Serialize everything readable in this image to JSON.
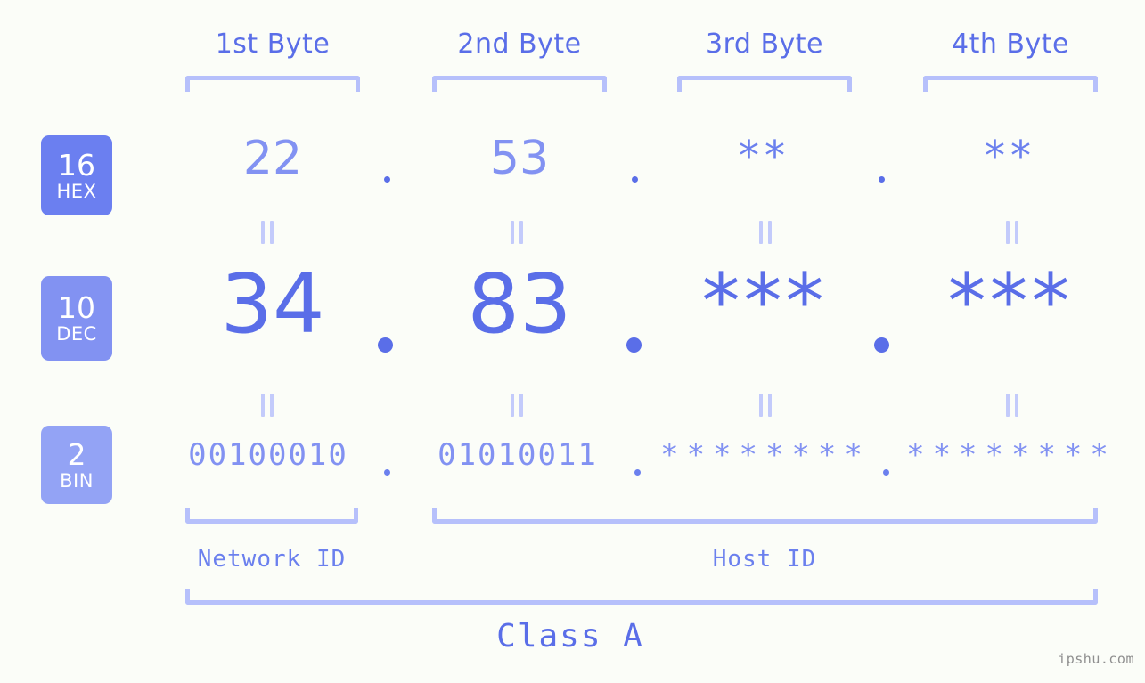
{
  "page": {
    "background_color": "#fbfdf8",
    "accent_color": "#5a6ee8",
    "accent_light_color": "#b6c0fb",
    "watermark": "ipshu.com"
  },
  "byte_headers": [
    {
      "label": "1st Byte"
    },
    {
      "label": "2nd Byte"
    },
    {
      "label": "3rd Byte"
    },
    {
      "label": "4th Byte"
    }
  ],
  "radix_badges": [
    {
      "number": "16",
      "name": "HEX",
      "color": "#6b7ff0"
    },
    {
      "number": "10",
      "name": "DEC",
      "color": "#8292f2"
    },
    {
      "number": "2",
      "name": "BIN",
      "color": "#93a3f5"
    }
  ],
  "rows": {
    "hex": {
      "radix": "16",
      "radix_name": "HEX",
      "bytes": [
        "22",
        "53",
        "**",
        "**"
      ],
      "separator": "."
    },
    "dec": {
      "radix": "10",
      "radix_name": "DEC",
      "bytes": [
        "34",
        "83",
        "***",
        "***"
      ],
      "separator": "."
    },
    "bin": {
      "radix": "2",
      "radix_name": "BIN",
      "bytes": [
        "00100010",
        "01010011",
        "********",
        "********"
      ],
      "separator": "."
    }
  },
  "equals_marks": {
    "glyph": "=",
    "count": 8
  },
  "sections": [
    {
      "label": "Network ID"
    },
    {
      "label": "Host ID"
    }
  ],
  "class": {
    "label": "Class A"
  }
}
